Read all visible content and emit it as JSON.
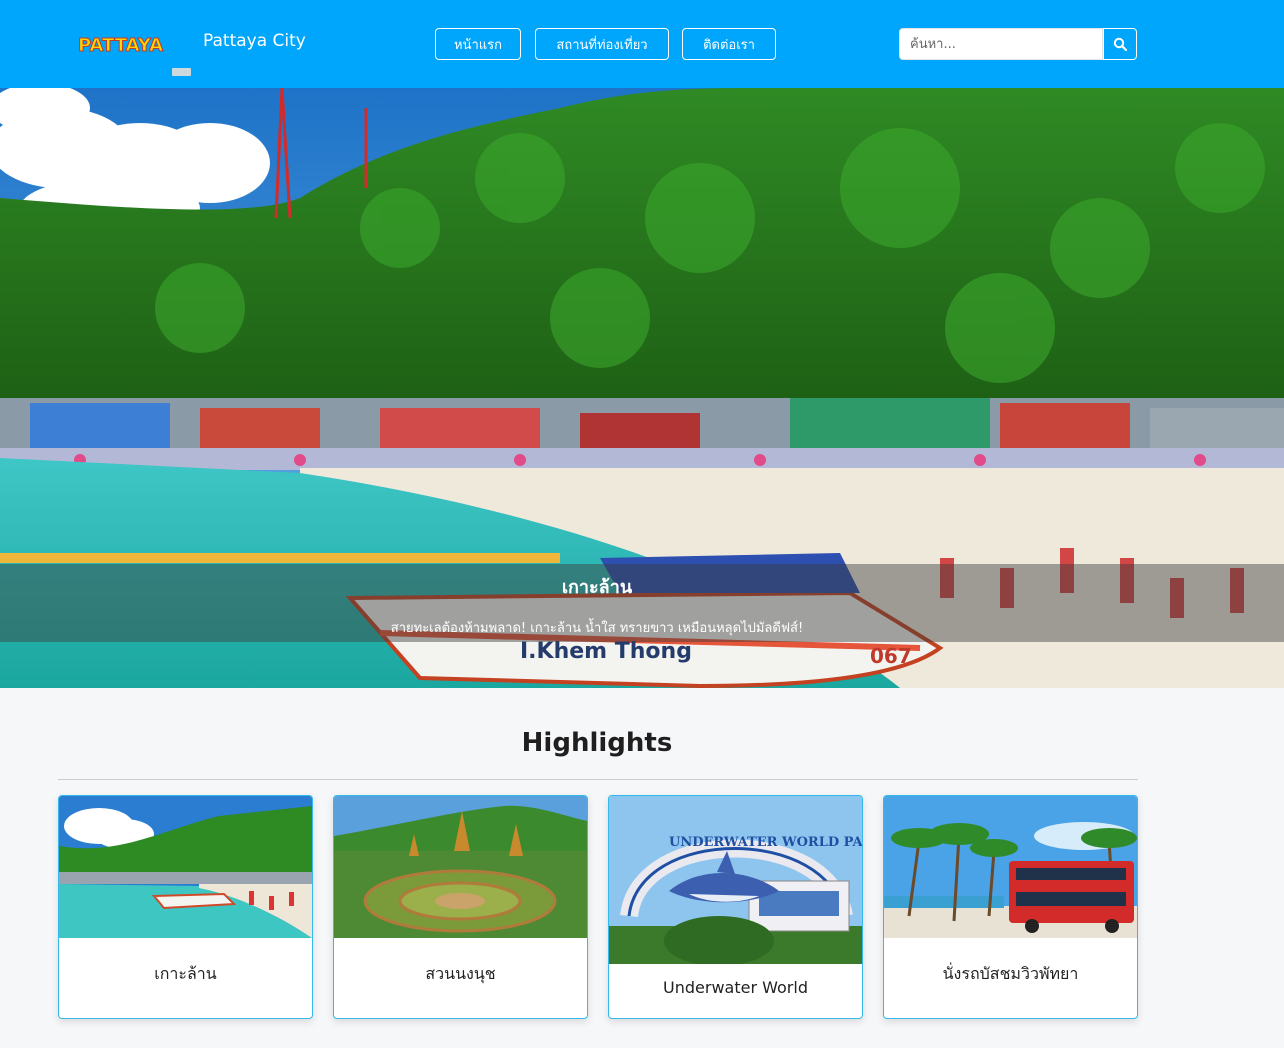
{
  "navbar": {
    "logo_text": "PATTAYA",
    "brand": "Pattaya City",
    "links": [
      "หน้าแรก",
      "สถานที่ท่องเที่ยว",
      "ติดต่อเรา"
    ],
    "search_placeholder": "ค้นหา...",
    "search_icon": "search-icon",
    "background": "#00a6fb"
  },
  "hero": {
    "title": "เกาะล้าน",
    "subtitle": "สายทะเลต้องห้ามพลาด! เกาะล้าน น้ำใส ทรายขาว เหมือนหลุดไปมัลดีฟส์!",
    "boat_name": "I.Khem Thong",
    "boat_number": "067"
  },
  "highlights": {
    "title": "Highlights",
    "cards": [
      {
        "label": "เกาะล้าน"
      },
      {
        "label": "สวนนงนุช"
      },
      {
        "label": "Underwater World",
        "sign_text": "UNDERWATER WORLD PATTAYA"
      },
      {
        "label": "นั่งรถบัสชมวิวพัทยา"
      }
    ]
  }
}
